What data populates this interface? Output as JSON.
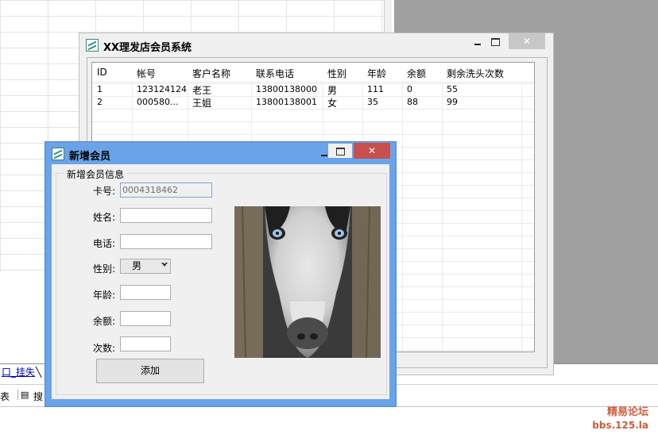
{
  "background": {
    "bottom_tab": "口_挂失",
    "toolbar_items": [
      "表",
      "搜"
    ],
    "watermark_line1": "精易论坛",
    "watermark_line2": "bbs.125.la"
  },
  "main_window": {
    "title": "XX理发店会员系统",
    "icon": "app-icon",
    "columns": [
      "ID",
      "帐号",
      "客户名称",
      "联系电话",
      "性别",
      "年龄",
      "余额",
      "剩余洗头次数"
    ],
    "rows": [
      [
        "1",
        "123124124",
        "老王",
        "13800138000",
        "男",
        "111",
        "0",
        "55"
      ],
      [
        "2",
        "000580...",
        "王姐",
        "13800138001",
        "女",
        "35",
        "88",
        "99"
      ]
    ]
  },
  "dialog": {
    "title": "新增会员",
    "icon": "app-icon",
    "group_label": "新增会员信息",
    "fields": {
      "card_label": "卡号:",
      "card_value": "0004318462",
      "name_label": "姓名:",
      "name_value": "",
      "phone_label": "电话:",
      "phone_value": "",
      "gender_label": "性别:",
      "gender_value": "男",
      "age_label": "年龄:",
      "age_value": "",
      "balance_label": "余额:",
      "balance_value": "",
      "count_label": "次数:",
      "count_value": ""
    },
    "add_button": "添加",
    "photo_icon": "husky-dog-photo"
  },
  "colors": {
    "dialog_titlebar": "#6aa3e8",
    "close_button_active": "#c7504f",
    "watermark": "#d25a3c"
  }
}
